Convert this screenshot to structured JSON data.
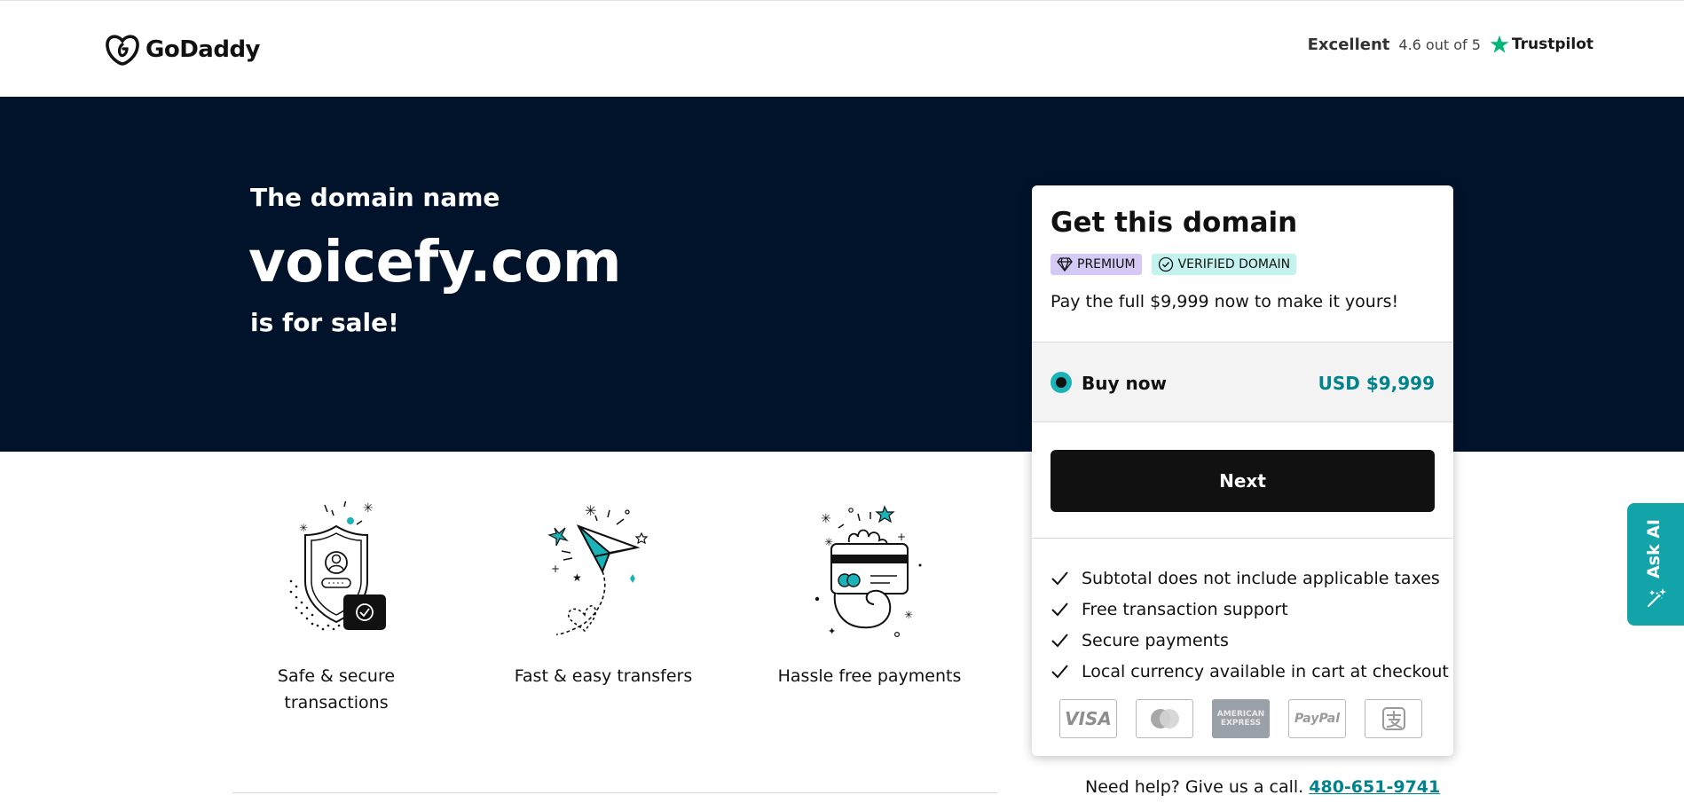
{
  "header": {
    "logo_text": "GoDaddy",
    "trust_excellent": "Excellent",
    "trust_rating": "4.6 out of 5",
    "trust_brand": "Trustpilot"
  },
  "hero": {
    "subtitle": "The domain name",
    "domain": "voicefy.com",
    "sale_text": "is for sale!"
  },
  "features": [
    {
      "label": "Safe & secure transactions",
      "icon": "shield-icon"
    },
    {
      "label": "Fast & easy transfers",
      "icon": "paper-plane-icon"
    },
    {
      "label": "Hassle free payments",
      "icon": "hand-card-icon"
    }
  ],
  "card": {
    "title": "Get this domain",
    "badge_premium": "PREMIUM",
    "badge_verified": "VERIFIED DOMAIN",
    "description": "Pay the full $9,999 now to make it yours!",
    "option_label": "Buy now",
    "option_price": "USD $9,999",
    "next_label": "Next",
    "checklist": [
      "Subtotal does not include applicable taxes",
      "Free transaction support",
      "Secure payments",
      "Local currency available in cart at checkout"
    ],
    "payment_methods": [
      "VISA",
      "Mastercard",
      "AMERICAN EXPRESS",
      "PayPal",
      "Alipay"
    ]
  },
  "help": {
    "text": "Need help? Give us a call.",
    "phone": "480-651-9741"
  },
  "ask_ai": {
    "label": "Ask AI"
  },
  "colors": {
    "hero_bg": "#00132b",
    "accent": "#1bb3b8",
    "price": "#00838c",
    "button": "#111111"
  }
}
